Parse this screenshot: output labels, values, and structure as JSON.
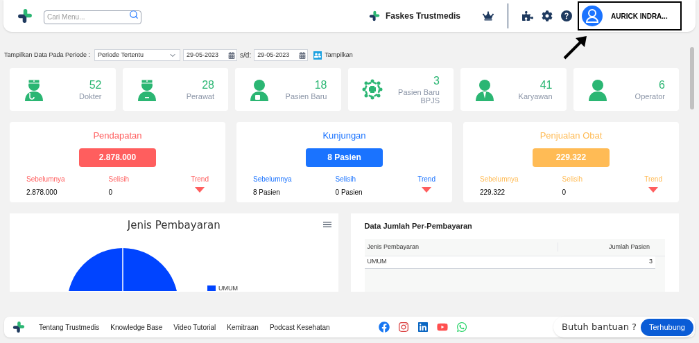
{
  "header": {
    "search": {
      "placeholder": "Cari Menu..."
    },
    "facility": "Faskes Trustmedis",
    "user": "AURICK INDRA..."
  },
  "filter": {
    "label": "Tampilkan Data Pada Periode :",
    "period": "Periode Tertentu",
    "date_from": "29-05-2023",
    "separator": "s/d:",
    "date_to": "29-05-2023",
    "button": "Tampilkan"
  },
  "stats": [
    {
      "kind": "doctor",
      "value": "52",
      "label": "Dokter"
    },
    {
      "kind": "nurse",
      "value": "28",
      "label": "Perawat"
    },
    {
      "kind": "patient",
      "value": "18",
      "label": "Pasien Baru"
    },
    {
      "kind": "group",
      "value": "3",
      "label": "Pasien Baru BPJS"
    },
    {
      "kind": "employee",
      "value": "41",
      "label": "Karyawan"
    },
    {
      "kind": "person",
      "value": "6",
      "label": "Operator"
    }
  ],
  "summaries": [
    {
      "title": "Pendapatan",
      "value": "2.878.000",
      "color": "#ff5e5e",
      "previous_label": "Sebelumnya",
      "previous": "2.878.000",
      "difference_label": "Selisih",
      "difference": "0",
      "trend_label": "Trend"
    },
    {
      "title": "Kunjungan",
      "value": "8 Pasien",
      "color": "#1a73ff",
      "previous_label": "Sebelumnya",
      "previous": "8 Pasien",
      "difference_label": "Selisih",
      "difference": "0 Pasien",
      "trend_label": "Trend"
    },
    {
      "title": "Penjualan Obat",
      "value": "229.322",
      "color": "#ffbb55",
      "previous_label": "Sebelumnya",
      "previous": "229.322",
      "difference_label": "Selisih",
      "difference": "0",
      "trend_label": "Trend"
    }
  ],
  "payment_chart": {
    "title": "Jenis Pembayaran",
    "legend": [
      {
        "label": "UMUM",
        "color": "#0044ff"
      }
    ]
  },
  "payment_table": {
    "title": "Data Jumlah Per-Pembayaran",
    "columns": [
      "Jenis Pembayaran",
      "Jumlah Pasien"
    ],
    "rows": [
      [
        "UMUM",
        "3"
      ]
    ]
  },
  "footer": {
    "links": [
      "Tentang Trustmedis",
      "Knowledge Base",
      "Video Tutorial",
      "Kemitraan",
      "Podcast Kesehatan"
    ],
    "help": "Butuh bantuan ?",
    "button": "Terhubung"
  }
}
